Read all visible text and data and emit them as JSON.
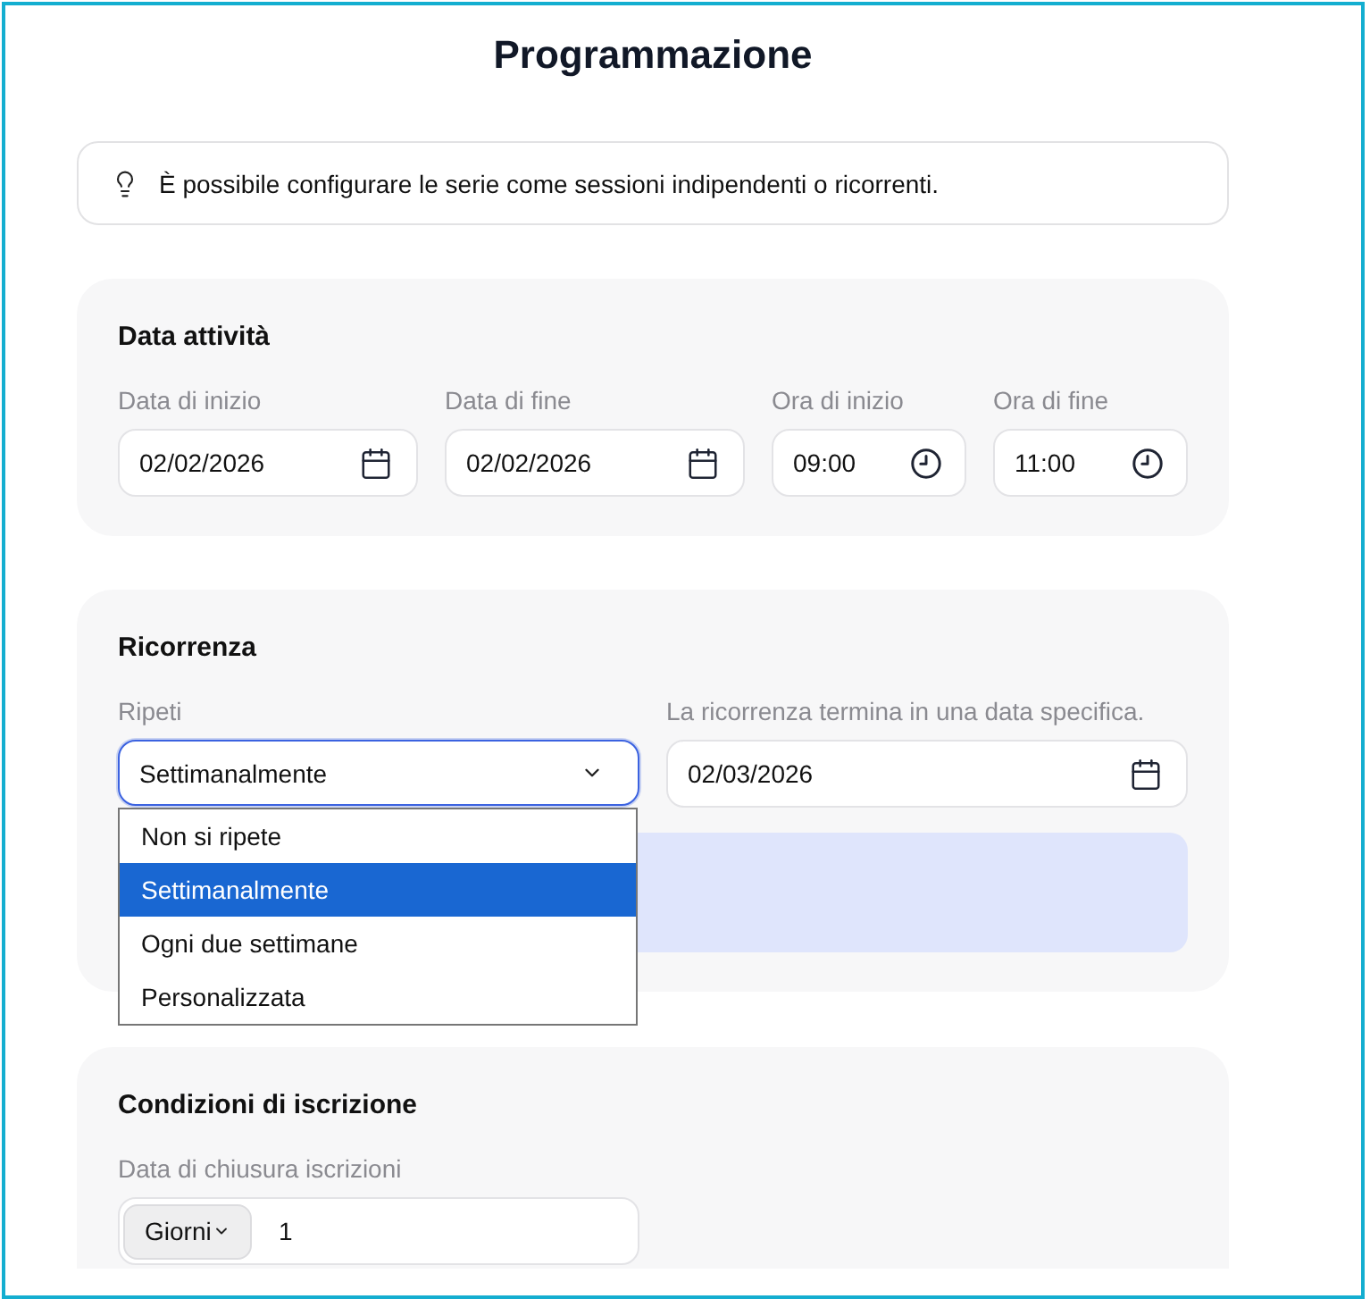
{
  "title": "Programmazione",
  "tip": {
    "text": "È possibile configurare le serie come sessioni indipendenti o ricorrenti."
  },
  "activity_dates": {
    "title": "Data attività",
    "fields": [
      {
        "kind": "date",
        "label": "Data di inizio",
        "value": "02/02/2026"
      },
      {
        "kind": "date",
        "label": "Data di fine",
        "value": "02/02/2026"
      },
      {
        "kind": "time",
        "label": "Ora di inizio",
        "value": "09:00"
      },
      {
        "kind": "time",
        "label": "Ora di fine",
        "value": "11:00"
      }
    ]
  },
  "recurrence": {
    "title": "Ricorrenza",
    "repeat": {
      "label": "Ripeti",
      "value": "Settimanalmente",
      "expanded": true,
      "options": [
        {
          "label": "Non si ripete",
          "selected": false
        },
        {
          "label": "Settimanalmente",
          "selected": true
        },
        {
          "label": "Ogni due settimane",
          "selected": false
        },
        {
          "label": "Personalizzata",
          "selected": false
        }
      ]
    },
    "end_date": {
      "label": "La ricorrenza termina in una data specifica.",
      "value": "02/03/2026"
    }
  },
  "enrollment": {
    "title": "Condizioni di iscrizione",
    "closing": {
      "label": "Data di chiusura iscrizioni",
      "unit": "Giorni",
      "value": "1"
    }
  }
}
